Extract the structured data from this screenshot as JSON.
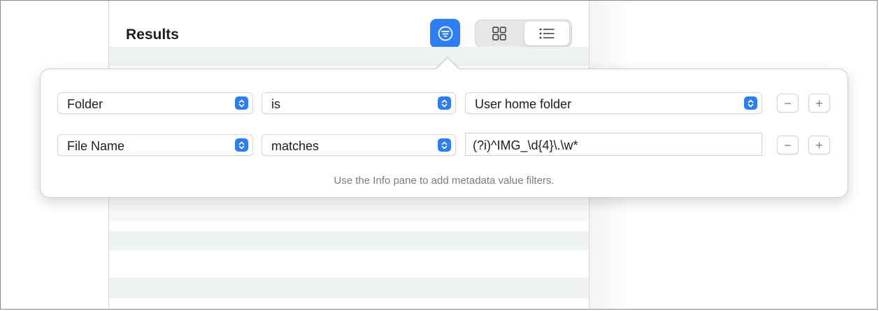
{
  "results": {
    "title": "Results"
  },
  "toolbar": {
    "filter_icon": "filter-icon",
    "views": [
      {
        "name": "grid",
        "icon": "grid-icon",
        "selected": false
      },
      {
        "name": "list",
        "icon": "list-icon",
        "selected": true
      }
    ]
  },
  "filters": {
    "rows": [
      {
        "field": "Folder",
        "operator": "is",
        "value": "User home folder",
        "value_type": "select"
      },
      {
        "field": "File Name",
        "operator": "matches",
        "value": "(?i)^IMG_\\d{4}\\.\\w*",
        "value_type": "text"
      }
    ],
    "remove_symbol": "−",
    "add_symbol": "+",
    "hint": "Use the Info pane to add metadata value filters."
  },
  "colors": {
    "accent": "#2b7ef6",
    "row_stripe": "#eef3f1"
  }
}
